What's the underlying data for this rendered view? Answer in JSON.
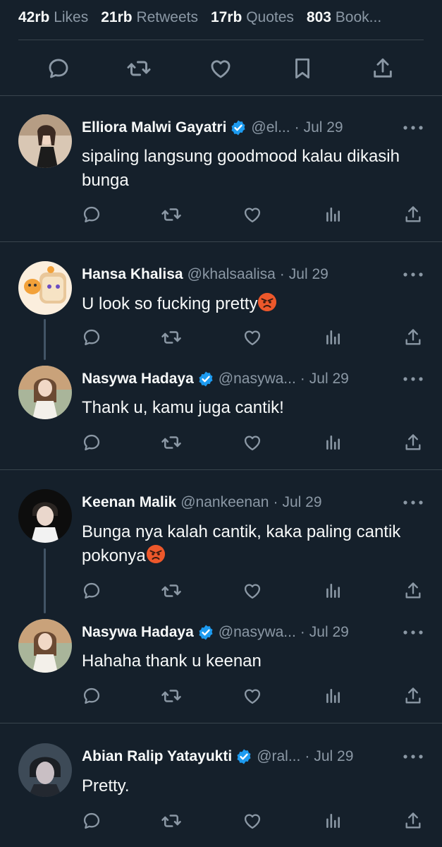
{
  "stats": [
    {
      "count": "42rb",
      "label": "Likes"
    },
    {
      "count": "21rb",
      "label": "Retweets"
    },
    {
      "count": "17rb",
      "label": "Quotes"
    },
    {
      "count": "803",
      "label": "Book..."
    }
  ],
  "main_actions": [
    "reply-icon",
    "retweet-icon",
    "like-icon",
    "bookmark-icon",
    "share-icon"
  ],
  "colors": {
    "background": "#15202b",
    "divider": "#38444d",
    "secondary_text": "#8b98a5",
    "verified": "#1d9bf0",
    "icon": "#8b98a5"
  },
  "replies": [
    {
      "name": "Elliora Malwi Gayatri",
      "verified": true,
      "handle": "@el...",
      "date": "Jul 29",
      "text": "sipaling langsung goodmood kalau dikasih bunga"
    },
    {
      "name": "Hansa Khalisa",
      "verified": false,
      "handle": "@khalsaalisa",
      "date": "Jul 29",
      "text": "U look so fucking pretty"
    },
    {
      "name": "Nasywa Hadaya",
      "verified": true,
      "handle": "@nasywa...",
      "date": "Jul 29",
      "text": "Thank u, kamu juga cantik!"
    },
    {
      "name": "Keenan Malik",
      "verified": false,
      "handle": "@nankeenan",
      "date": "Jul 29",
      "text_line1": "Bunga nya kalah cantik, kaka paling cantik",
      "text_line2": "pokonya"
    },
    {
      "name": "Nasywa Hadaya",
      "verified": true,
      "handle": "@nasywa...",
      "date": "Jul 29",
      "text": "Hahaha thank u keenan"
    },
    {
      "name": "Abian Ralip Yatayukti",
      "verified": true,
      "handle": "@ral...",
      "date": "Jul 29",
      "text": "Pretty."
    }
  ],
  "separator": "·",
  "reply_actions": [
    "reply-icon",
    "retweet-icon",
    "like-icon",
    "views-icon",
    "share-icon"
  ]
}
